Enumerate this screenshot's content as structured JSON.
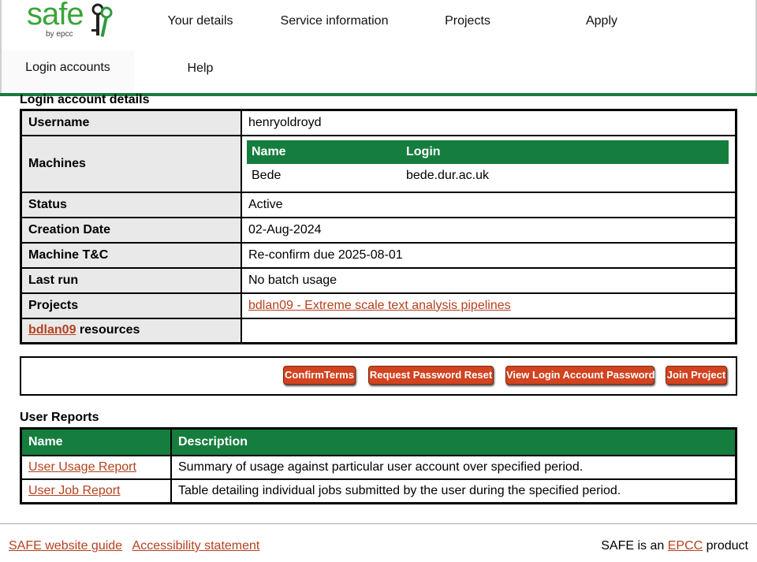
{
  "brand": {
    "logo_text": "safe",
    "logo_byline": "by epcc",
    "accent_color": "#157d3d",
    "button_color": "#d2431f",
    "link_color": "#b5411f"
  },
  "nav": {
    "your_details": "Your details",
    "service_information": "Service information",
    "projects": "Projects",
    "apply": "Apply",
    "login_accounts": "Login accounts",
    "help": "Help"
  },
  "account": {
    "heading": "Login account details",
    "username_label": "Username",
    "username": "henryoldroyd",
    "machines_label": "Machines",
    "machines_header": {
      "name": "Name",
      "login": "Login"
    },
    "machines": [
      {
        "name": "Bede",
        "login": "bede.dur.ac.uk"
      }
    ],
    "status_label": "Status",
    "status": "Active",
    "creation_label": "Creation Date",
    "creation_date": "02-Aug-2024",
    "tc_label": "Machine T&C",
    "tc_value": "Re-confirm due 2025-08-01",
    "lastrun_label": "Last run",
    "lastrun_value": "No batch usage",
    "projects_label": "Projects",
    "project_link": "bdlan09 - Extreme scale text analysis pipelines",
    "resources_project": "bdlan09",
    "resources_suffix": " resources",
    "resources_value": ""
  },
  "actions": {
    "confirm_terms": "ConfirmTerms",
    "request_password_reset": "Request Password Reset",
    "view_password": "View Login Account Password",
    "join_project": "Join Project"
  },
  "reports": {
    "heading": "User Reports",
    "columns": [
      "Name",
      "Description"
    ],
    "rows": [
      {
        "name": "User Usage Report",
        "description": "Summary of usage against particular user account over specified period."
      },
      {
        "name": "User Job Report",
        "description": "Table detailing individual jobs submitted by the user during the specified period."
      }
    ]
  },
  "footer": {
    "guide_link": "SAFE website guide",
    "accessibility_link": "Accessibility statement",
    "product_prefix": "SAFE is an ",
    "product_link": "EPCC",
    "product_suffix": " product"
  }
}
